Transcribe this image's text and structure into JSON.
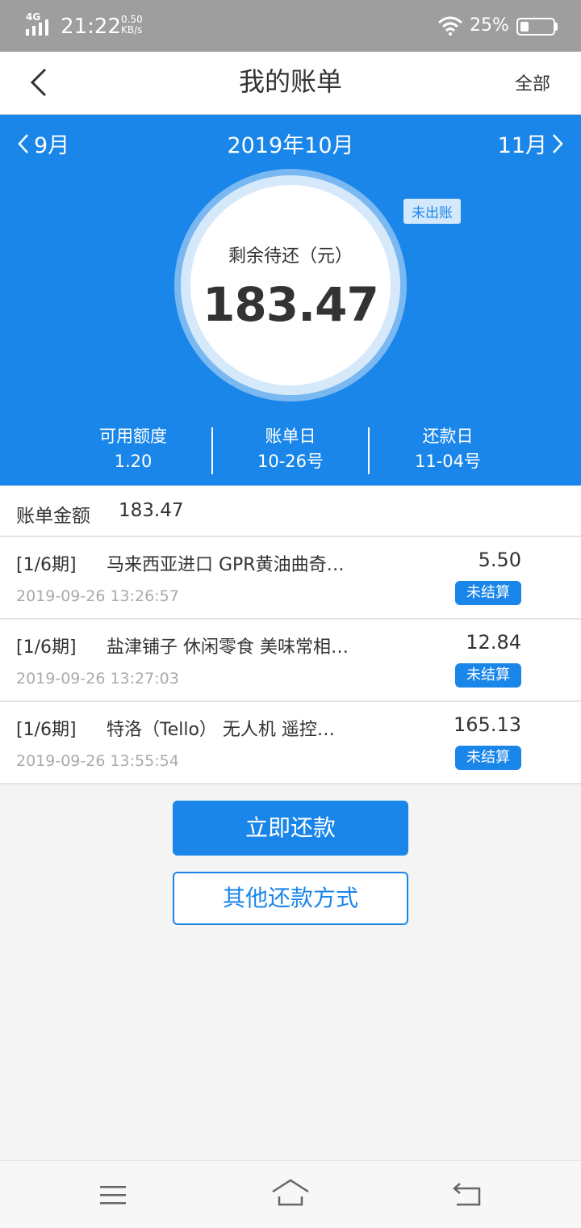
{
  "status_bar": {
    "network": "4G",
    "time": "21:22",
    "speed_value": "0.50",
    "speed_unit": "KB/s",
    "battery": "25%"
  },
  "header": {
    "title": "我的账单",
    "right_label": "全部"
  },
  "month_nav": {
    "prev": "9月",
    "current": "2019年10月",
    "next": "11月"
  },
  "summary": {
    "remaining_label": "剩余待还（元）",
    "remaining_amount": "183.47",
    "status_badge": "未出账"
  },
  "stats": [
    {
      "title": "可用额度",
      "value": "1.20"
    },
    {
      "title": "账单日",
      "value": "10-26号"
    },
    {
      "title": "还款日",
      "value": "11-04号"
    }
  ],
  "bill_total": {
    "label": "账单金额",
    "value": "183.47"
  },
  "transactions": [
    {
      "period": "[1/6期]",
      "name": "马来西亚进口 GPR黄油曲奇…",
      "date": "2019-09-26 13:26:57",
      "amount": "5.50",
      "status": "未结算"
    },
    {
      "period": "[1/6期]",
      "name": "盐津铺子 休闲零食 美味常相…",
      "date": "2019-09-26 13:27:03",
      "amount": "12.84",
      "status": "未结算"
    },
    {
      "period": "[1/6期]",
      "name": "特洛（Tello） 无人机 遥控…",
      "date": "2019-09-26 13:55:54",
      "amount": "165.13",
      "status": "未结算"
    }
  ],
  "actions": {
    "primary": "立即还款",
    "secondary": "其他还款方式"
  },
  "colors": {
    "brand_blue": "#1a86e9",
    "status_bar": "#9e9e9e"
  }
}
